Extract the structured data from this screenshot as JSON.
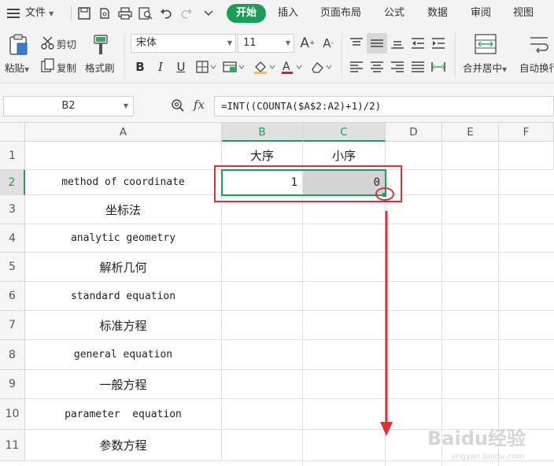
{
  "menubar": {
    "file_label": "文件",
    "tabs": [
      "开始",
      "插入",
      "页面布局",
      "公式",
      "数据",
      "审阅",
      "视图"
    ]
  },
  "ribbon": {
    "paste_label": "粘贴",
    "cut_label": "剪切",
    "copy_label": "复制",
    "format_painter_label": "格式刷",
    "font_name": "宋体",
    "font_size": "11",
    "merge_center_label": "合并居中",
    "wrap_text_label": "自动换行"
  },
  "formula_bar": {
    "cell_ref": "B2",
    "fx_label": "fx",
    "formula": "=INT((COUNTA($A$2:A2)+1)/2)"
  },
  "sheet": {
    "columns": [
      "A",
      "B",
      "C",
      "D",
      "E",
      "F"
    ],
    "rows": [
      "1",
      "2",
      "3",
      "4",
      "5",
      "6",
      "7",
      "8",
      "9",
      "10",
      "11"
    ],
    "cells": {
      "B1": "大序",
      "C1": "小序",
      "A2": "method of coordinate",
      "B2": "1",
      "C2": "0",
      "A3": "坐标法",
      "A4": "analytic geometry",
      "A5": "解析几何",
      "A6": "standard equation",
      "A7": "标准方程",
      "A8": "general equation",
      "A9": "一般方程",
      "A10": "parameter  equation",
      "A11": "参数方程"
    }
  },
  "watermark": {
    "text": "Baidu经验",
    "sub": "jingyan.baidu.com"
  },
  "colors": {
    "accent": "#1a9e59",
    "annotation": "#d9333a"
  }
}
